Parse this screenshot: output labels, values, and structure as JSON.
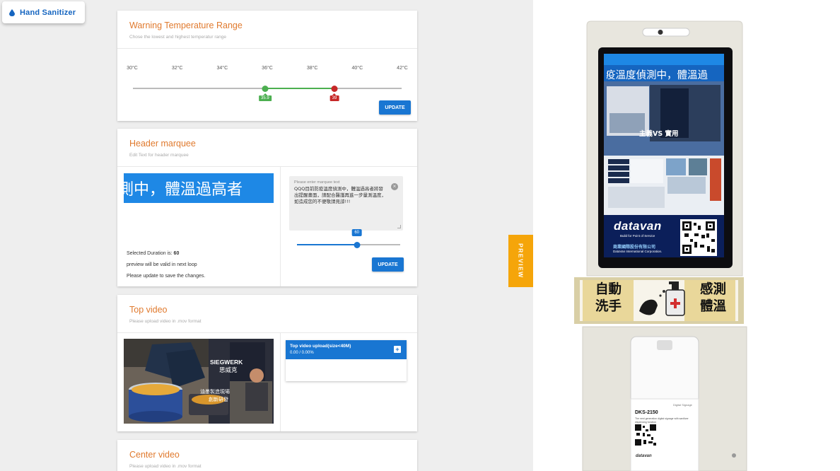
{
  "app": {
    "name": "Hand Sanitizer"
  },
  "temperature_card": {
    "title": "Warning Temperature Range",
    "subtitle": "Chose the lowest and highest temperatur range",
    "ticks": [
      "30°C",
      "32°C",
      "34°C",
      "36°C",
      "38°C",
      "40°C",
      "42°C"
    ],
    "scale_min": 30,
    "scale_max": 42,
    "low_value": 35.9,
    "low_label": "35.9",
    "high_value": 39,
    "high_label": "39",
    "low_color": "#4caf50",
    "high_color": "#c62828",
    "update_label": "UPDATE"
  },
  "marquee_card": {
    "title": "Header marquee",
    "subtitle": "Edit Text for header marquee",
    "preview_text": "測中，體溫過高者",
    "duration_label": "Selected Duration is:",
    "duration_value": "60",
    "note_1": "preview will be valid in next loop",
    "note_2": "Please update to save the changes.",
    "input_placeholder": "Please enter marquee text",
    "input_value": "QQQ目前防疫溫度偵測中，體溫過高者將發出提醒畫面，請配合醫護再進一步量測溫度，如造成您的不便敬請見諒!!!",
    "slider_value": 60,
    "slider_fraction": 0.58,
    "update_label": "UPDATE",
    "accent_color": "#1976d2"
  },
  "top_video_card": {
    "title": "Top video",
    "subtitle": "Please upload video in .mov format",
    "video_caption_en": "SIEGWERK",
    "video_caption_cn": "思威克",
    "video_subtitle_1": "油墨製造現場",
    "video_subtitle_2": "創新研發",
    "upload_title": "Top video upload(size<40M)",
    "upload_progress": "0.00 / 0.00%"
  },
  "center_video_card": {
    "title": "Center video",
    "subtitle": "Please upload video in .mov format"
  },
  "preview_tab": {
    "label": "PREVIEW",
    "color": "#f5a50a"
  },
  "kiosk": {
    "screen_marquee": "疫溫度偵測中，體溫過",
    "screen_center_text": "主義VS 實用",
    "brand": "datavan",
    "brand_tagline": "Build for Point of Service",
    "company_cn": "商業國際股份有限公司",
    "company_en": "DataVan International Corporation.",
    "sticker_left": [
      "自動",
      "洗手"
    ],
    "sticker_right": [
      "感測",
      "體溫"
    ],
    "model": "DKS-2150",
    "model_desc": "The next generation digital signage with sanitizer dispensing function",
    "model_type": "Digital Signage",
    "bottom_brand": "datavan"
  }
}
